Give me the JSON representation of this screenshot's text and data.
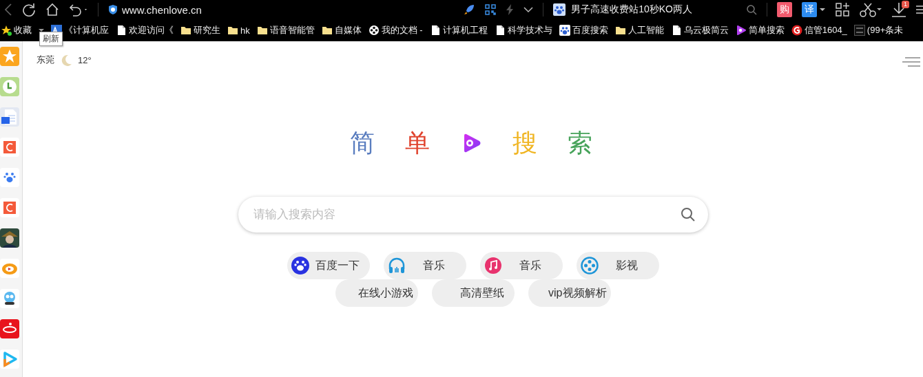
{
  "toolbar": {
    "url": "www.chenlove.cn",
    "tab_title": "男子高速收费站10秒KO两人",
    "buttons": [
      {
        "label": "购",
        "kind": "shop"
      },
      {
        "label": "译",
        "kind": "translate"
      }
    ],
    "download_badge": "1"
  },
  "bookmarks": [
    {
      "label": "收藏",
      "kind": "star"
    },
    {
      "label": "《计算机应",
      "kind": "az"
    },
    {
      "label": "欢迎访问《",
      "kind": "page"
    },
    {
      "label": "研究生",
      "kind": "folder"
    },
    {
      "label": "hk",
      "kind": "folder"
    },
    {
      "label": "语音智能管",
      "kind": "folder"
    },
    {
      "label": "自媒体",
      "kind": "folder"
    },
    {
      "label": "我的文档 -",
      "kind": "reel"
    },
    {
      "label": "计算机工程",
      "kind": "page"
    },
    {
      "label": "科学技术与",
      "kind": "page"
    },
    {
      "label": "百度搜索",
      "kind": "baidu"
    },
    {
      "label": "人工智能",
      "kind": "folder"
    },
    {
      "label": "乌云极简云",
      "kind": "page"
    },
    {
      "label": "简单搜索",
      "kind": "jiandan"
    },
    {
      "label": "信管1604_",
      "kind": "g"
    },
    {
      "label": "(99+条未",
      "kind": "pic"
    }
  ],
  "tooltip": "刷新",
  "weather": {
    "city": "东莞",
    "temperature": "12°"
  },
  "logo": [
    {
      "char": "简",
      "color": "#5a7dbf"
    },
    {
      "char": "单",
      "color": "#e0442f"
    },
    {
      "char": "搜",
      "color": "#f0b522"
    },
    {
      "char": "索",
      "color": "#47a35a"
    }
  ],
  "search": {
    "placeholder": "请输入搜索内容"
  },
  "quick_links": [
    [
      {
        "label": "百度一下",
        "kind": "baidu"
      },
      {
        "label": "音乐",
        "kind": "headphones"
      },
      {
        "label": "音乐",
        "kind": "music"
      },
      {
        "label": "影视",
        "kind": "film"
      }
    ],
    [
      {
        "label": "在线小游戏",
        "kind": "none"
      },
      {
        "label": "高清壁纸",
        "kind": "none"
      },
      {
        "label": "vip视频解析",
        "kind": "none"
      }
    ]
  ]
}
